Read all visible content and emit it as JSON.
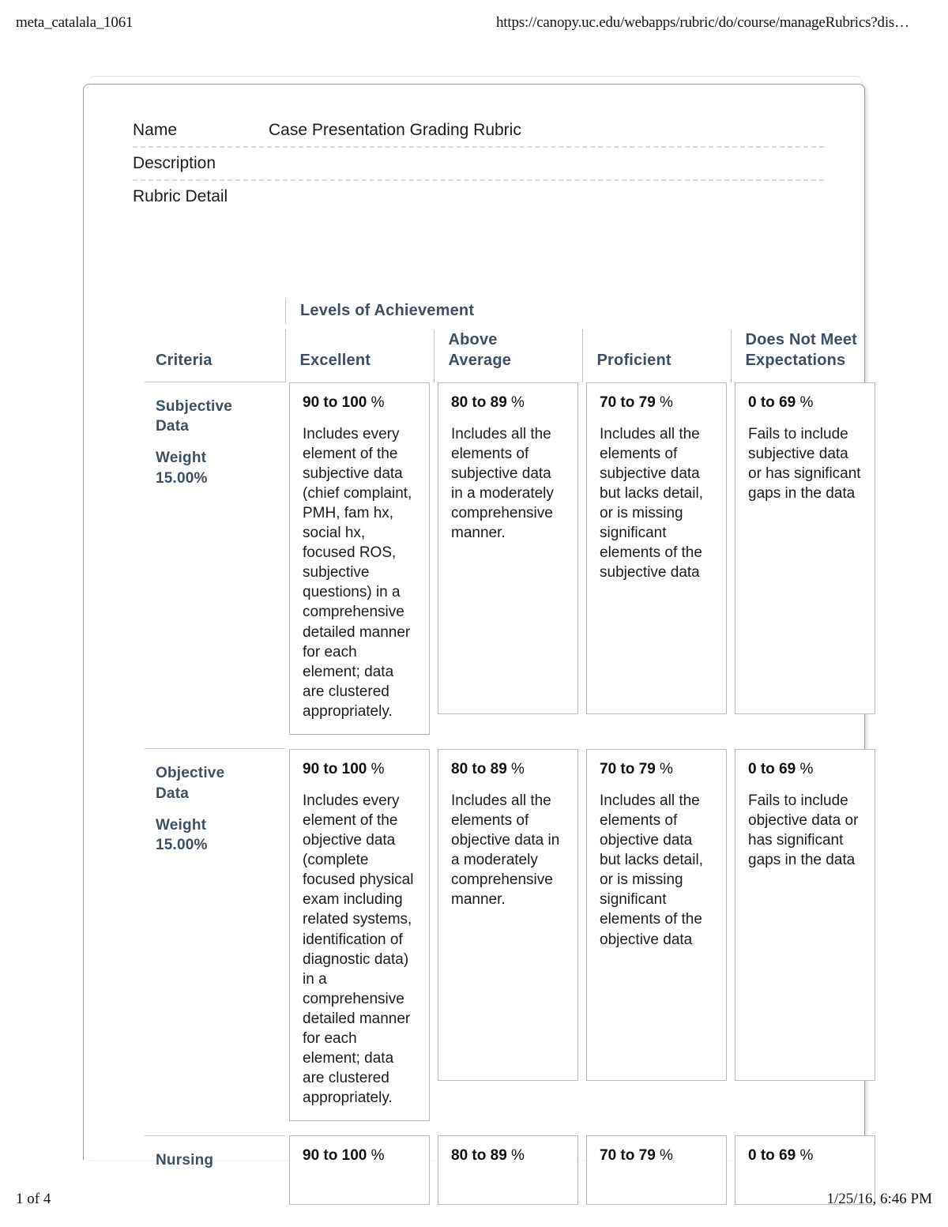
{
  "print_header": {
    "left": "meta_catalala_1061",
    "right": "https://canopy.uc.edu/webapps/rubric/do/course/manageRubrics?dis…"
  },
  "print_footer": {
    "page": "1 of 4",
    "timestamp": "1/25/16, 6:46 PM"
  },
  "meta": {
    "name_label": "Name",
    "name_value": "Case Presentation Grading Rubric",
    "description_label": "Description",
    "description_value": "",
    "rubric_detail_label": "Rubric Detail"
  },
  "table": {
    "levels_of_achievement_label": "Levels of Achievement",
    "headers": {
      "criteria": "Criteria",
      "excellent": "Excellent",
      "above_average": "Above\nAverage",
      "proficient": "Proficient",
      "does_not_meet": "Does Not Meet\nExpectations"
    },
    "weight_label": "Weight",
    "rows": [
      {
        "criteria": "Subjective\nData",
        "weight": "15.00%",
        "cells": [
          {
            "score_range": "90 to 100",
            "pct": "%",
            "description": "Includes every element of the subjective data (chief complaint, PMH, fam hx, social hx, focused ROS, subjective questions) in a comprehensive detailed manner for each element; data are clustered appropriately."
          },
          {
            "score_range": "80 to 89",
            "pct": "%",
            "description": "Includes all the elements of subjective data in a moderately comprehensive manner."
          },
          {
            "score_range": "70 to 79",
            "pct": "%",
            "description": "Includes all the elements of subjective data but lacks detail, or is missing significant elements of the subjective data"
          },
          {
            "score_range": "0 to 69",
            "pct": "%",
            "description": "Fails to include subjective data or has significant gaps in the data"
          }
        ]
      },
      {
        "criteria": "Objective\nData",
        "weight": "15.00%",
        "cells": [
          {
            "score_range": "90 to 100",
            "pct": "%",
            "description": "Includes every element of the objective data (complete focused physical exam including related systems, identification of diagnostic data) in a comprehensive detailed manner for each element; data are clustered appropriately."
          },
          {
            "score_range": "80 to 89",
            "pct": "%",
            "description": "Includes all the elements of objective data in a moderately comprehensive manner."
          },
          {
            "score_range": "70 to 79",
            "pct": "%",
            "description": "Includes all the elements of objective data but lacks detail, or is missing significant elements of the objective data"
          },
          {
            "score_range": "0 to 69",
            "pct": "%",
            "description": "Fails to include objective data or has significant gaps in the data"
          }
        ]
      },
      {
        "criteria": "Nursing",
        "weight": "",
        "cells": [
          {
            "score_range": "90 to 100",
            "pct": "%",
            "description": ""
          },
          {
            "score_range": "80 to 89",
            "pct": "%",
            "description": ""
          },
          {
            "score_range": "70 to 79",
            "pct": "%",
            "description": ""
          },
          {
            "score_range": "0 to 69",
            "pct": "%",
            "description": ""
          }
        ]
      }
    ]
  },
  "colors": {
    "heading": "#3d4f63",
    "body_text": "#1c1c1c",
    "cell_border": "#b9b9b9",
    "rule": "#c9c9c9"
  }
}
